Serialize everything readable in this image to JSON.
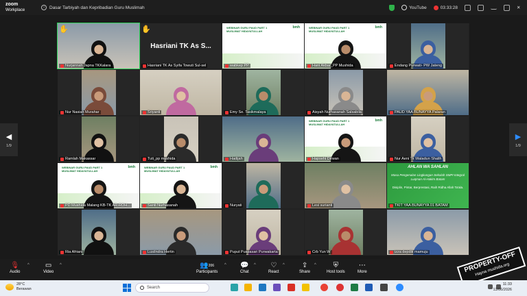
{
  "app": {
    "brand_line1": "zoom",
    "brand_line2": "Workplace"
  },
  "meeting": {
    "title": "Dasar Tarbiyah dan Kepribadian Guru Muslimah"
  },
  "topbar": {
    "streaming": "YouTube",
    "timer": "03:33:28"
  },
  "colors": {
    "accent_green": "#2fd35c",
    "mic_off": "#e33333",
    "blue_arrow": "#2d8cff",
    "card_green": "#2d9a3e"
  },
  "tiles": [
    {
      "name": "Nurjannah Japna TKKalara",
      "muted": true,
      "hand_raised": true,
      "selected": true,
      "type": "video"
    },
    {
      "name": "Hasriani TK As Syifa Towuti Sul-sel",
      "muted": true,
      "hand_raised": true,
      "type": "name",
      "display": "Hasriani TK As S..."
    },
    {
      "name": "wabkep PP",
      "muted": true,
      "type": "banner"
    },
    {
      "name": "Hani Akbar_PP Mushida",
      "muted": true,
      "type": "banner"
    },
    {
      "name": "Endang Purwati- PW Jateng",
      "muted": true,
      "type": "video"
    },
    {
      "name": "Nur Nasiah Murahar",
      "muted": true,
      "type": "video"
    },
    {
      "name": "Sriyanti",
      "muted": true,
      "type": "video"
    },
    {
      "name": "Emy Se. Tasikmalaya",
      "muted": true,
      "type": "video"
    },
    {
      "name": "Aisyah Nurhasanah Salsabila",
      "muted": true,
      "type": "video"
    },
    {
      "name": "PAUD YAA BUNAYYA Palaran",
      "muted": true,
      "type": "video"
    },
    {
      "name": "Ramlah Makassar",
      "muted": true,
      "type": "video"
    },
    {
      "name": "Tuti_pp mushida",
      "muted": true,
      "type": "video"
    },
    {
      "name": "Hadijah",
      "muted": true,
      "type": "video"
    },
    {
      "name": "Hapsehi Dirwan",
      "muted": true,
      "type": "banner"
    },
    {
      "name": "Nur Aeni Tk Waladun Shalih",
      "muted": true,
      "type": "video"
    },
    {
      "name": "PD Mushida Malang KB-TK AR-ROH...",
      "muted": true,
      "type": "banner"
    },
    {
      "name": "Santi Nurhasanah",
      "muted": true,
      "type": "banner"
    },
    {
      "name": "Nuryati",
      "muted": true,
      "type": "video"
    },
    {
      "name": "Lesi surianti",
      "muted": true,
      "type": "video"
    },
    {
      "name": "TKIT YAA BUNAYYA 01 BATAM",
      "muted": true,
      "type": "card"
    },
    {
      "name": "Ria Afriani",
      "muted": true,
      "type": "video"
    },
    {
      "name": "LusiIndra Hertin",
      "muted": true,
      "type": "video"
    },
    {
      "name": "Puput Puspasari Purwakarta",
      "muted": true,
      "type": "video"
    },
    {
      "name": "Crb Yun W",
      "muted": true,
      "type": "video"
    },
    {
      "name": "izza depdik mamuju",
      "muted": true,
      "type": "video"
    }
  ],
  "banner": {
    "text": "WEBINAR GURU PAUD PART 1 MUSLIMAT HIDAYATULLAH",
    "logo": "bmh"
  },
  "card": {
    "line1": "AHLAN WA SAHLAN",
    "line2": "Masa Pengenalan Lingkungan Sekolah SMPI Integral Luqman Al-Hakim Batam",
    "line3": "Disiplin, Pintar, Berprestasi, Raih Ridha Allah Ta'ala."
  },
  "pager": {
    "left": "1/9",
    "right": "1/9"
  },
  "toolbar": {
    "audio": "Audio",
    "video": "Video",
    "participants": "Participants",
    "participants_count": "206",
    "chat": "Chat",
    "react": "React",
    "share": "Share",
    "host_tools": "Host tools",
    "more": "More"
  },
  "watermark": {
    "line1": "PROPERTY-OFF",
    "line2": "Hayna mushida.org"
  },
  "taskbar": {
    "temp": "28°C",
    "weather": "Berawan",
    "search_placeholder": "Search",
    "time": "11:33",
    "date": "13/06/2026"
  }
}
